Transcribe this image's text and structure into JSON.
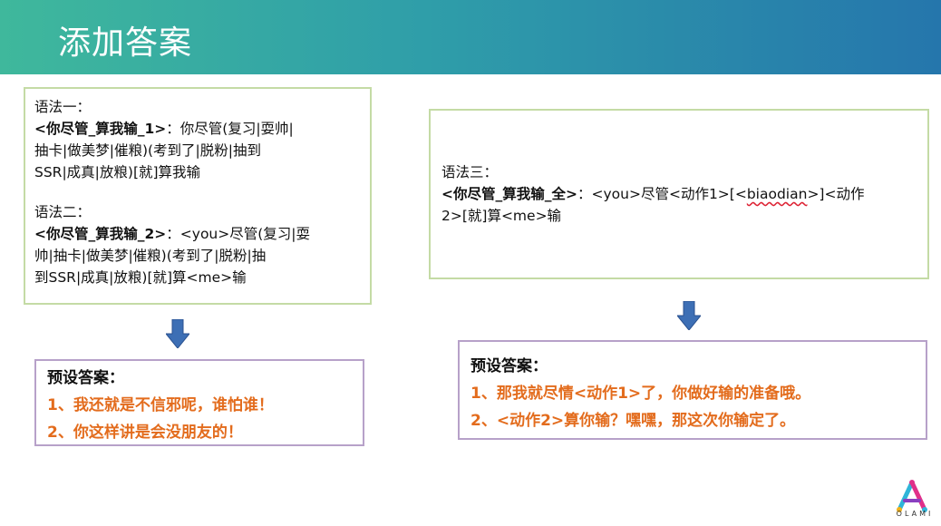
{
  "header": {
    "title": "添加答案"
  },
  "left_box": {
    "g1_label": "语法一：",
    "g1_name": "<你尽管_算我输_1>",
    "g1_colon": "：",
    "g1_body_l1": "你尽管(复习|耍帅|",
    "g1_body_l2": "抽卡|做美梦|催粮)(考到了|脱粉|抽到",
    "g1_body_l3": "SSR|成真|放粮)[就]算我输",
    "g2_label": "语法二：",
    "g2_name": "<你尽管_算我输_2>",
    "g2_colon": "：",
    "g2_body_l1": "<you>尽管(复习|耍",
    "g2_body_l2": "帅|抽卡|做美梦|催粮)(考到了|脱粉|抽",
    "g2_body_l3": "到SSR|成真|放粮)[就]算<me>输"
  },
  "right_box": {
    "g3_label": "语法三：",
    "g3_name": "<你尽管_算我输_全>",
    "g3_colon": "：",
    "g3_body_a": "<you>尽管<动作1>[<",
    "g3_body_wavy": "biaodian",
    "g3_body_b": ">]<动作",
    "g3_body_l2": "2>[就]算<me>输"
  },
  "left_preset": {
    "title": "预设答案：",
    "line1": "1、我还就是不信邪呢，谁怕谁！",
    "line2": "2、你这样讲是会没朋友的！"
  },
  "right_preset": {
    "title": "预设答案：",
    "line1": "1、那我就尽情<动作1>了，你做好输的准备哦。",
    "line2": "2、<动作2>算你输？嘿嘿，那这次你输定了。"
  },
  "logo": {
    "text": "OLAMI"
  },
  "colors": {
    "header_start": "#3fb89c",
    "header_end": "#2576ac",
    "answer_orange": "#e36c1d",
    "arrow_blue": "#3d6fb5",
    "green_border": "#c4dba5",
    "purple_border": "#b7a1c9"
  }
}
